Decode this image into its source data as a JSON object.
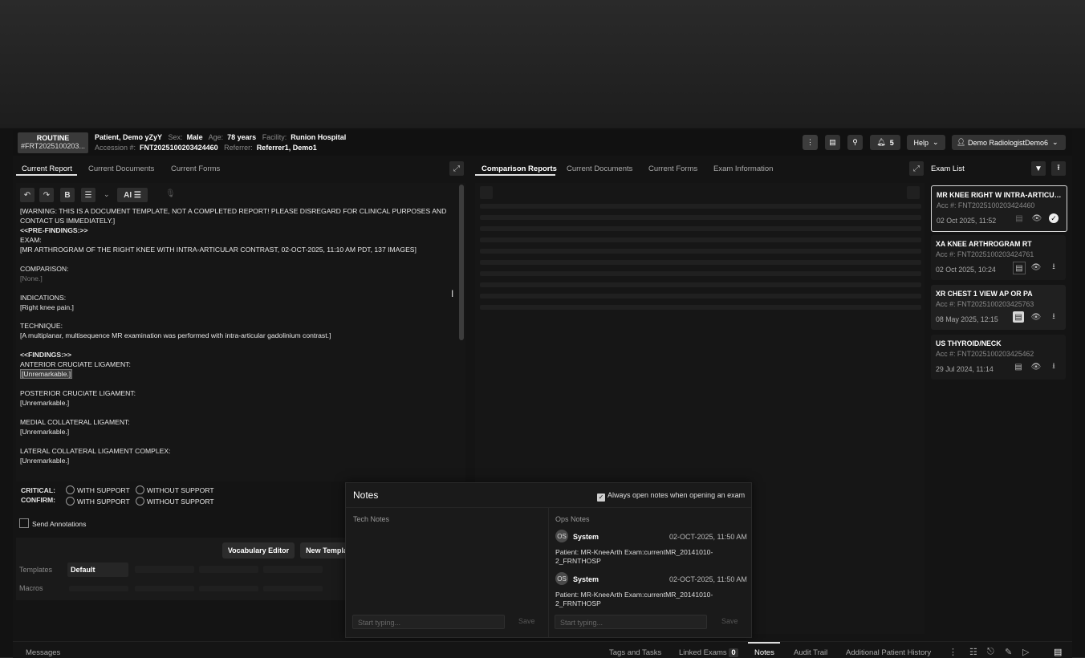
{
  "header": {
    "priority": "ROUTINE",
    "accession_short": "#FRT2025100203...",
    "patient_name": "Patient, Demo yZyY",
    "sex_label": "Sex:",
    "sex": "Male",
    "age_label": "Age:",
    "age": "78 years",
    "facility_label": "Facility:",
    "facility": "Runion Hospital",
    "accession_label": "Accession #:",
    "accession": "FNT2025100203424460",
    "referrer_label": "Referrer:",
    "referrer": "Referrer1, Demo1",
    "notification_count": "5",
    "help_label": "Help",
    "user_name": "Demo RadiologistDemo6"
  },
  "left_tabs": [
    "Current Report",
    "Current Documents",
    "Current Forms"
  ],
  "middle_tabs": [
    "Comparison Reports",
    "Current Documents",
    "Current Forms",
    "Exam Information"
  ],
  "toolbar": {
    "ai_label": "AI"
  },
  "report_lines": [
    {
      "text": "[WARNING: THIS IS A DOCUMENT TEMPLATE, NOT A COMPLETED REPORT! PLEASE DISREGARD FOR CLINICAL PURPOSES AND",
      "style": ""
    },
    {
      "text": "CONTACT US IMMEDIATELY.]",
      "style": ""
    },
    {
      "text": "<<PRE-FINDINGS:>>",
      "style": "b"
    },
    {
      "text": "EXAM:",
      "style": ""
    },
    {
      "text": "[MR ARTHROGRAM OF THE RIGHT KNEE WITH INTRA-ARTICULAR CONTRAST, 02-OCT-2025, 11:10 AM PDT, 137 IMAGES]",
      "style": ""
    },
    {
      "text": "",
      "style": ""
    },
    {
      "text": "COMPARISON:",
      "style": ""
    },
    {
      "text": "[None.]",
      "style": "dim"
    },
    {
      "text": "",
      "style": ""
    },
    {
      "text": "INDICATIONS:",
      "style": ""
    },
    {
      "text": "[Right knee pain.]",
      "style": ""
    },
    {
      "text": "",
      "style": ""
    },
    {
      "text": "TECHNIQUE:",
      "style": ""
    },
    {
      "text": "[A multiplanar, multisequence MR examination was performed with intra-articular gadolinium contrast.]",
      "style": ""
    },
    {
      "text": "",
      "style": ""
    },
    {
      "text": "<<FINDINGS:>>",
      "style": "b"
    },
    {
      "text": "ANTERIOR CRUCIATE LIGAMENT:",
      "style": ""
    },
    {
      "text": "[Unremarkable.]",
      "style": "hl"
    },
    {
      "text": "",
      "style": ""
    },
    {
      "text": "POSTERIOR CRUCIATE LIGAMENT:",
      "style": ""
    },
    {
      "text": "[Unremarkable.]",
      "style": ""
    },
    {
      "text": "",
      "style": ""
    },
    {
      "text": "MEDIAL COLLATERAL LIGAMENT:",
      "style": ""
    },
    {
      "text": "[Unremarkable.]",
      "style": ""
    },
    {
      "text": "",
      "style": ""
    },
    {
      "text": "LATERAL COLLATERAL LIGAMENT COMPLEX:",
      "style": ""
    },
    {
      "text": "[Unremarkable.]",
      "style": ""
    }
  ],
  "critical": {
    "critical_label": "CRITICAL:",
    "confirm_label": "CONFIRM:",
    "with_support": "WITH SUPPORT",
    "without_support": "WITHOUT SUPPORT",
    "send_annotations": "Send Annotations"
  },
  "bottom_left": {
    "vocab_editor": "Vocabulary Editor",
    "new_template": "New Templa",
    "templates_label": "Templates",
    "templates_value": "Default",
    "macros_label": "Macros"
  },
  "exam_list": {
    "title": "Exam List",
    "items": [
      {
        "title": "MR KNEE RIGHT W INTRA-ARTICUL...",
        "acc": "Acc #: FNT2025100203424460",
        "date": "02 Oct 2025, 11:52"
      },
      {
        "title": "XA KNEE ARTHROGRAM RT",
        "acc": "Acc #: FNT2025100203424761",
        "date": "02 Oct 2025, 10:24"
      },
      {
        "title": "XR CHEST 1 VIEW AP OR PA",
        "acc": "Acc #: FNT2025100203425763",
        "date": "08 May 2025, 12:15"
      },
      {
        "title": "US THYROID/NECK",
        "acc": "Acc #: FNT2025100203425462",
        "date": "29 Jul 2024, 11:14"
      }
    ]
  },
  "notes": {
    "title": "Notes",
    "always_open": "Always open notes when opening an exam",
    "tech_title": "Tech Notes",
    "ops_title": "Ops Notes",
    "placeholder": "Start typing...",
    "save": "Save",
    "entries": [
      {
        "initials": "OS",
        "author": "System",
        "time": "02-OCT-2025, 11:50 AM",
        "line1": "Patient: MR-KneeArth Exam:currentMR_20141010-",
        "line2": "2_FRNTHOSP"
      },
      {
        "initials": "OS",
        "author": "System",
        "time": "02-OCT-2025, 11:50 AM",
        "line1": "Patient: MR-KneeArth Exam:currentMR_20141010-",
        "line2": "2_FRNTHOSP"
      }
    ]
  },
  "footer": {
    "messages": "Messages",
    "tags": "Tags and Tasks",
    "linked": "Linked Exams",
    "linked_count": "0",
    "notes": "Notes",
    "audit": "Audit Trail",
    "history": "Additional Patient History"
  }
}
